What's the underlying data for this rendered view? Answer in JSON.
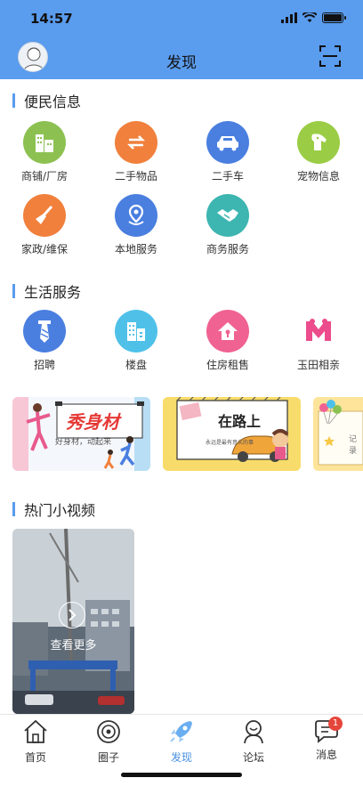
{
  "status_bar": {
    "time": "14:57"
  },
  "header": {
    "title": "发现"
  },
  "sections": {
    "convenience": {
      "title": "便民信息",
      "items": [
        {
          "label": "商铺/厂房",
          "icon": "building-icon",
          "color": "#8cc152"
        },
        {
          "label": "二手物品",
          "icon": "exchange-icon",
          "color": "#f0803c"
        },
        {
          "label": "二手车",
          "icon": "car-icon",
          "color": "#4a7fe0"
        },
        {
          "label": "宠物信息",
          "icon": "dog-icon",
          "color": "#9acd45"
        },
        {
          "label": "家政/维保",
          "icon": "broom-icon",
          "color": "#f0803c"
        },
        {
          "label": "本地服务",
          "icon": "location-icon",
          "color": "#4a7fe0"
        },
        {
          "label": "商务服务",
          "icon": "handshake-icon",
          "color": "#3db5b0"
        }
      ]
    },
    "life": {
      "title": "生活服务",
      "items": [
        {
          "label": "招聘",
          "icon": "tie-icon",
          "color": "#4a7fe0"
        },
        {
          "label": "楼盘",
          "icon": "buildings-icon",
          "color": "#4fc1e9"
        },
        {
          "label": "住房租售",
          "icon": "house-icon",
          "color": "#f06292"
        },
        {
          "label": "玉田相亲",
          "icon": "match-icon",
          "color": "#ec4c8c"
        }
      ]
    },
    "videos": {
      "title": "热门小视频",
      "more_label": "查看更多"
    }
  },
  "banners": [
    {
      "title": "秀身材",
      "subtitle": "好身材，动起来"
    },
    {
      "title": "在路上",
      "subtitle": "永远是最有意义的事"
    },
    {
      "title": "记录"
    }
  ],
  "tabbar": {
    "items": [
      {
        "label": "首页",
        "icon": "home-icon"
      },
      {
        "label": "圈子",
        "icon": "circle-icon"
      },
      {
        "label": "发现",
        "icon": "rocket-icon",
        "active": true
      },
      {
        "label": "论坛",
        "icon": "forum-icon"
      },
      {
        "label": "消息",
        "icon": "message-icon",
        "badge": "1"
      }
    ]
  }
}
